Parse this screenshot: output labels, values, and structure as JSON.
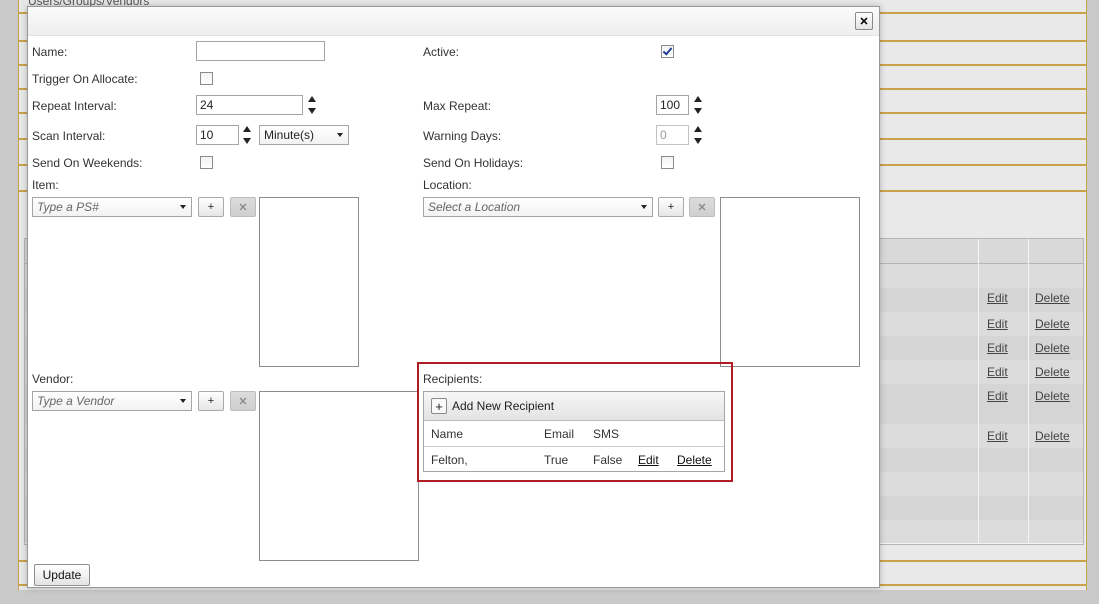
{
  "background": {
    "breadcrumb": "Users/Groups/Vendors",
    "edit_label": "Edit",
    "delete_label": "Delete"
  },
  "dialog": {
    "close_icon": "close-icon",
    "fields": {
      "name_label": "Name:",
      "name_value": "",
      "active_label": "Active:",
      "active_checked": true,
      "trigger_label": "Trigger On Allocate:",
      "trigger_checked": false,
      "repeat_interval_label": "Repeat Interval:",
      "repeat_interval_value": "24",
      "max_repeat_label": "Max Repeat:",
      "max_repeat_value": "100",
      "scan_interval_label": "Scan Interval:",
      "scan_interval_value": "10",
      "scan_unit": "Minute(s)",
      "warning_days_label": "Warning Days:",
      "warning_days_value": "0",
      "weekends_label": "Send On Weekends:",
      "weekends_checked": false,
      "holidays_label": "Send On Holidays:",
      "holidays_checked": false
    },
    "item": {
      "label": "Item:",
      "placeholder": "Type a PS#",
      "add_label": "+"
    },
    "location": {
      "label": "Location:",
      "placeholder": "Select a Location",
      "add_label": "+"
    },
    "vendor": {
      "label": "Vendor:",
      "placeholder": "Type a Vendor",
      "add_label": "+"
    },
    "recipients": {
      "label": "Recipients:",
      "add_button": "Add New Recipient",
      "columns": [
        "Name",
        "Email",
        "SMS"
      ],
      "rows": [
        {
          "name": "Felton,",
          "email": "True",
          "sms": "False",
          "edit": "Edit",
          "delete": "Delete"
        }
      ]
    },
    "update_button": "Update"
  }
}
